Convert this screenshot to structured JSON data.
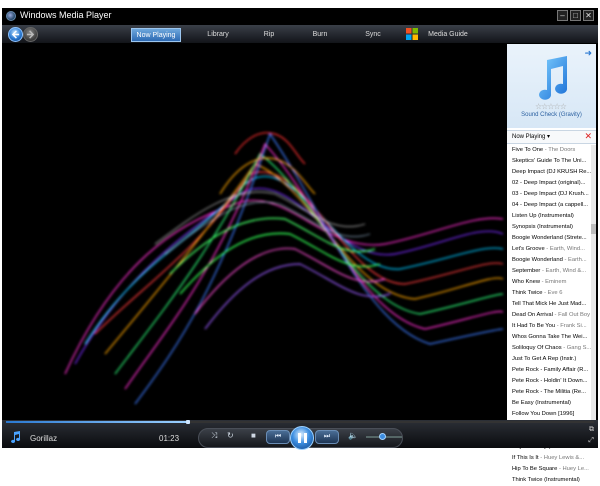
{
  "window": {
    "title": "Windows Media Player"
  },
  "nav": {
    "tabs": [
      {
        "label": "Now Playing",
        "active": true
      },
      {
        "label": "Library",
        "active": false
      },
      {
        "label": "Rip",
        "active": false
      },
      {
        "label": "Burn",
        "active": false
      },
      {
        "label": "Sync",
        "active": false
      },
      {
        "label": "Media Guide",
        "active": false
      }
    ]
  },
  "side_panel": {
    "album": "Sound Check (Gravity)",
    "rating": 0,
    "playlist_label": "Now Playing",
    "playlist": [
      {
        "title": "Five To One",
        "artist": " - The Doors"
      },
      {
        "title": "Skeptics' Guide To The Uni...",
        "artist": ""
      },
      {
        "title": "Deep Impact (DJ KRUSH Re...",
        "artist": ""
      },
      {
        "title": "02 - Deep Impact (original)...",
        "artist": ""
      },
      {
        "title": "03 - Deep Impact (DJ Krush...",
        "artist": ""
      },
      {
        "title": "04 - Deep Impact (a cappell...",
        "artist": ""
      },
      {
        "title": "Listen Up (Instrumental)",
        "artist": ""
      },
      {
        "title": "Synopsis (Instrumental)",
        "artist": ""
      },
      {
        "title": "Boogie Wonderland (Strete...",
        "artist": ""
      },
      {
        "title": "Let's Groove",
        "artist": " - Earth, Wind..."
      },
      {
        "title": "Boogie Wonderland",
        "artist": " - Earth..."
      },
      {
        "title": "September",
        "artist": " - Earth, Wind &..."
      },
      {
        "title": "Who Knew",
        "artist": " - Eminem"
      },
      {
        "title": "Think Twice",
        "artist": " - Eve 6"
      },
      {
        "title": "Tell That Mick He Just Mad...",
        "artist": ""
      },
      {
        "title": "Dead On Arrival",
        "artist": " - Fall Out Boy"
      },
      {
        "title": "It Had To Be You",
        "artist": " - Frank Si..."
      },
      {
        "title": "Whos Gonna Take The Wei...",
        "artist": ""
      },
      {
        "title": "Soliloquy Of Chaos",
        "artist": " - Gang S..."
      },
      {
        "title": "Just To Get A Rep (Instr.)",
        "artist": ""
      },
      {
        "title": "Pete Rock - Family Affair (R...",
        "artist": ""
      },
      {
        "title": "Pete Rock - Holdin' It Down...",
        "artist": ""
      },
      {
        "title": "Pete Rock - The Militia (Re...",
        "artist": ""
      },
      {
        "title": "Be Easy (Instrumental)",
        "artist": ""
      },
      {
        "title": "Follow You Down [1996]",
        "artist": ""
      },
      {
        "title": "Sound Check (Gravity)",
        "artist": "",
        "current": true
      },
      {
        "title": "Sound Check (Gravity)",
        "artist": ""
      },
      {
        "title": "Hey Jealousy (Gin Blossoms...",
        "artist": ""
      },
      {
        "title": "If This Is It",
        "artist": " - Huey Lewis &..."
      },
      {
        "title": "Hip To Be Square",
        "artist": " - Huey Le..."
      },
      {
        "title": "Think Twice (Instrumental)",
        "artist": ""
      }
    ]
  },
  "player": {
    "artist": "Gorillaz",
    "time": "01:23",
    "seek_fraction": 0.31,
    "volume_fraction": 0.45
  },
  "icons": {
    "back": "back-arrow-icon",
    "forward": "forward-arrow-icon",
    "note": "music-note-icon",
    "windows": "windows-logo-icon"
  },
  "colors": {
    "accent": "#2a79d1",
    "current_track": "#1a63b8"
  }
}
